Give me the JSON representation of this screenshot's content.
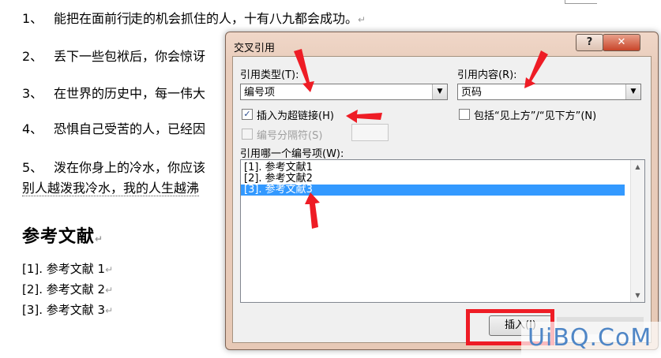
{
  "document": {
    "lines": [
      {
        "num": "1、",
        "text_before_cursor": "能把在面前行",
        "text_after_cursor": "走的机会抓住的人，十有八九都会成功。"
      },
      {
        "num": "2、",
        "text": "丢下一些包袱后，你会惊讶"
      },
      {
        "num": "3、",
        "text": "在世界的历史中，每一伟大"
      },
      {
        "num": "4、",
        "text": "恐惧自己受苦的人，已经因"
      },
      {
        "num": "5、",
        "text": "泼在你身上的冷水，你应该"
      }
    ],
    "line5_continuation": "别人越泼我冷水，我的人生越沸",
    "heading": "参考文献",
    "references": [
      "[1].  参考文献 1",
      "[2].  参考文献 2",
      "[3].  参考文献 3"
    ],
    "pilcrow": "↵"
  },
  "dialog": {
    "title": "交叉引用",
    "help_label": "?",
    "close_label": "✕",
    "ref_type_label": "引用类型(T):",
    "ref_type_value": "编号项",
    "ref_content_label": "引用内容(R):",
    "ref_content_value": "页码",
    "insert_hyperlink_label": "插入为超链接(H)",
    "insert_hyperlink_checked": true,
    "include_above_below_label": "包括“见上方”/“见下方”(N)",
    "separator_label": "编号分隔符(S)",
    "which_item_label": "引用哪一个编号项(W):",
    "items": [
      "[1]. 参考文献1",
      "[2]. 参考文献2",
      "[3]. 参考文献3"
    ],
    "selected_index": 2,
    "insert_button_label": "插入(I)",
    "check_mark": "✓",
    "dropdown_arrow": "▼",
    "scroll_up": "▲",
    "scroll_down": "▼"
  },
  "watermark": "UiBQ.CoM",
  "colors": {
    "annotation_red": "#ee1c25",
    "selection_blue": "#3399ff",
    "watermark_blue": "#4f86c6"
  }
}
